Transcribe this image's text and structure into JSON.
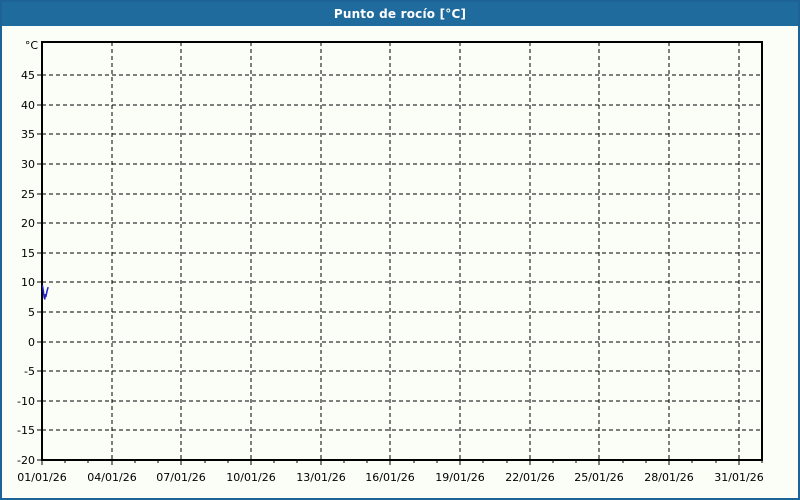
{
  "window": {
    "title": "Punto de rocío [°C]"
  },
  "colors": {
    "titlebar": "#206b9e",
    "titlebar_text": "#ffffff",
    "widget_border": "#1d6398",
    "content_background": "#fbfdf7",
    "axis": "#000000",
    "grid": "#000000",
    "series": "#2222cc"
  },
  "chart_data": {
    "type": "line",
    "title": "Punto de rocío [°C]",
    "y_axis_unit_label": "°C",
    "ylim": [
      -20,
      50.6
    ],
    "yticks": [
      45,
      40,
      35,
      30,
      25,
      20,
      15,
      10,
      5,
      0,
      -5,
      -10,
      -15,
      -20
    ],
    "xlim_days": [
      0,
      31
    ],
    "x_total_days": 31,
    "x_label_days": [
      0,
      3,
      6,
      9,
      12,
      15,
      18,
      21,
      24,
      27,
      30
    ],
    "x_tick_labels": [
      "01/01/26",
      "04/01/26",
      "07/01/26",
      "10/01/26",
      "13/01/26",
      "16/01/26",
      "19/01/26",
      "22/01/26",
      "25/01/26",
      "28/01/26",
      "31/01/26"
    ],
    "x_minor_tick_every_days": 1,
    "grid": "dashed",
    "legend": "none",
    "series": [
      {
        "name": "Punto de rocío",
        "color": "#2222cc",
        "points": [
          {
            "day": 0.02,
            "value": 9.4
          },
          {
            "day": 0.06,
            "value": 8.5
          },
          {
            "day": 0.09,
            "value": 7.5
          },
          {
            "day": 0.12,
            "value": 7.2
          },
          {
            "day": 0.14,
            "value": 7.9
          },
          {
            "day": 0.17,
            "value": 7.6
          },
          {
            "day": 0.22,
            "value": 8.6
          },
          {
            "day": 0.26,
            "value": 9.1
          }
        ]
      }
    ]
  }
}
